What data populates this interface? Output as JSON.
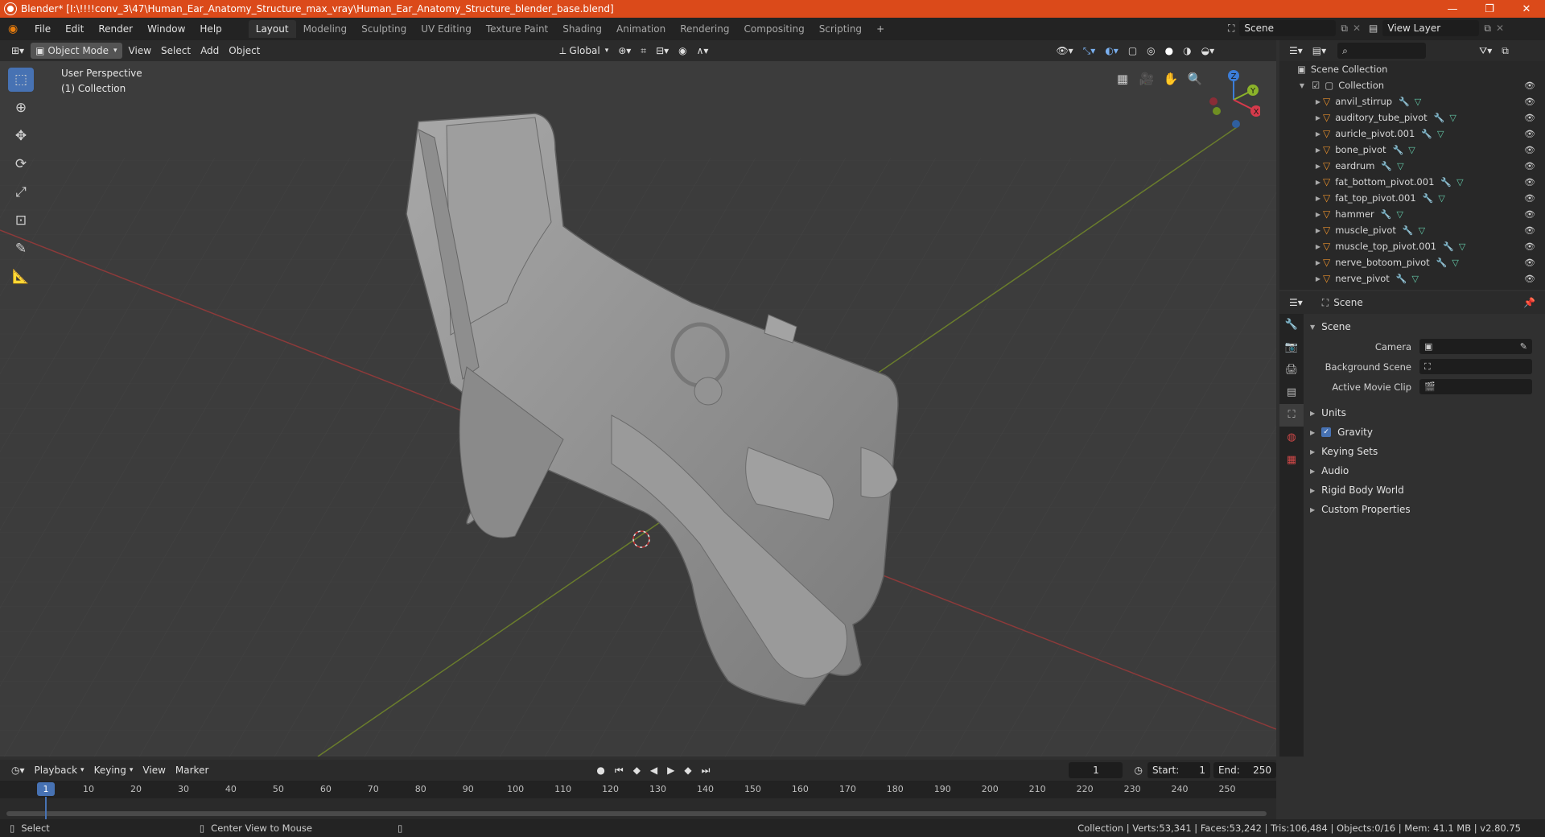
{
  "window": {
    "title": "Blender* [I:\\!!!!conv_3\\47\\Human_Ear_Anatomy_Structure_max_vray\\Human_Ear_Anatomy_Structure_blender_base.blend]",
    "minimize": "—",
    "maximize": "❐",
    "close": "✕"
  },
  "menu": [
    "File",
    "Edit",
    "Render",
    "Window",
    "Help"
  ],
  "workspaces": [
    "Layout",
    "Modeling",
    "Sculpting",
    "UV Editing",
    "Texture Paint",
    "Shading",
    "Animation",
    "Rendering",
    "Compositing",
    "Scripting"
  ],
  "active_workspace": "Layout",
  "scene_field": "Scene",
  "view_layer_field": "View Layer",
  "viewport_header": {
    "mode": "Object Mode",
    "menus": [
      "View",
      "Select",
      "Add",
      "Object"
    ],
    "orientation": "Global"
  },
  "viewport": {
    "perspective_label": "User Perspective",
    "collection_label": "(1) Collection",
    "gizmo_axes": {
      "x": "X",
      "y": "Y",
      "z": "Z"
    }
  },
  "outliner": {
    "root": "Scene Collection",
    "collection": "Collection",
    "items": [
      "anvil_stirrup",
      "auditory_tube_pivot",
      "auricle_pivot.001",
      "bone_pivot",
      "eardrum",
      "fat_bottom_pivot.001",
      "fat_top_pivot.001",
      "hammer",
      "muscle_pivot",
      "muscle_top_pivot.001",
      "nerve_botoom_pivot",
      "nerve_pivot"
    ]
  },
  "properties": {
    "header": "Scene",
    "panel": "Scene",
    "fields": [
      {
        "label": "Camera"
      },
      {
        "label": "Background Scene"
      },
      {
        "label": "Active Movie Clip"
      }
    ],
    "sections": [
      "Units",
      "Gravity",
      "Keying Sets",
      "Audio",
      "Rigid Body World",
      "Custom Properties"
    ],
    "gravity_checked": true
  },
  "timeline": {
    "menus": [
      "Playback",
      "Keying",
      "View",
      "Marker"
    ],
    "current_frame": "1",
    "start_label": "Start:",
    "start": "1",
    "end_label": "End:",
    "end": "250",
    "ticks": [
      "1",
      "10",
      "20",
      "30",
      "40",
      "50",
      "60",
      "70",
      "80",
      "90",
      "100",
      "110",
      "120",
      "130",
      "140",
      "150",
      "160",
      "170",
      "180",
      "190",
      "200",
      "210",
      "220",
      "230",
      "240",
      "250"
    ]
  },
  "status": {
    "select": "Select",
    "center": "Center View to Mouse",
    "stats": "Collection | Verts:53,341 | Faces:53,242 | Tris:106,484 | Objects:0/16 | Mem: 41.1 MB | v2.80.75"
  }
}
